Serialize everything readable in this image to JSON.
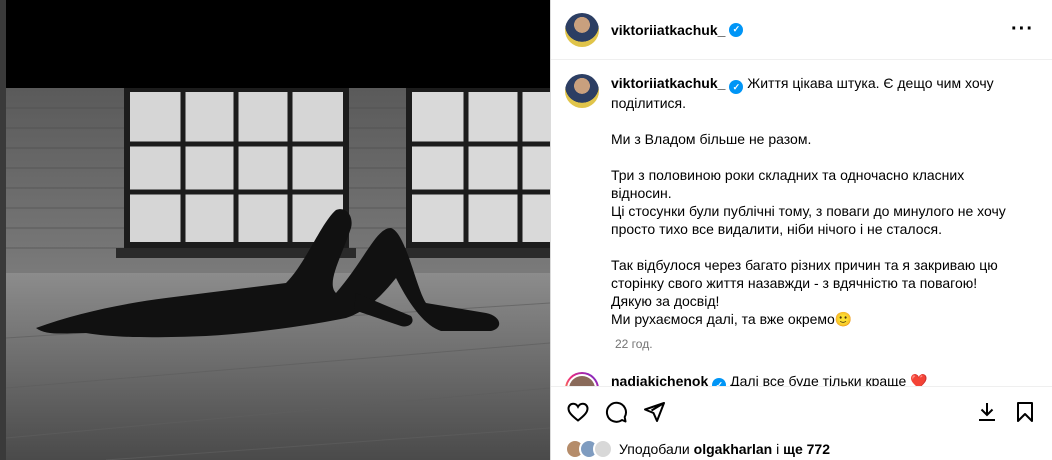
{
  "post": {
    "author": "viktoriiatkachuk_",
    "caption_lines": [
      "Життя цікава штука. Є дещо чим хочу",
      "поділитися.",
      "Ми з Владом більше не разом.",
      "Три з половиною роки складних та одночасно класних",
      "відносин.",
      "Ці стосунки були публічні тому, з поваги до минулого не хочу",
      "просто тихо все видалити, ніби нічого і не сталося.",
      "Так відбулося через багато різних причин та я закриваю цю",
      "сторінку свого життя назавжди - з вдячністю та повагою!",
      "Дякую за досвід!",
      "Ми рухаємося далі, та вже окремо🙂"
    ],
    "time_ago": "22 год."
  },
  "comment": {
    "author": "nadiakichenok",
    "text": "Далі все буде тільки краще ❤️"
  },
  "likes": {
    "prefix": "Уподобали",
    "user": "olgakharlan",
    "suffix_label": "і",
    "more": "ще 772"
  },
  "icons": {
    "like": "heart-icon",
    "comment": "comment-icon",
    "share": "send-icon",
    "save": "bookmark-icon",
    "download": "download-icon",
    "more": "more-icon"
  },
  "colors": {
    "verified": "#0095f6",
    "meta": "#737373",
    "border": "#dbdbdb"
  }
}
